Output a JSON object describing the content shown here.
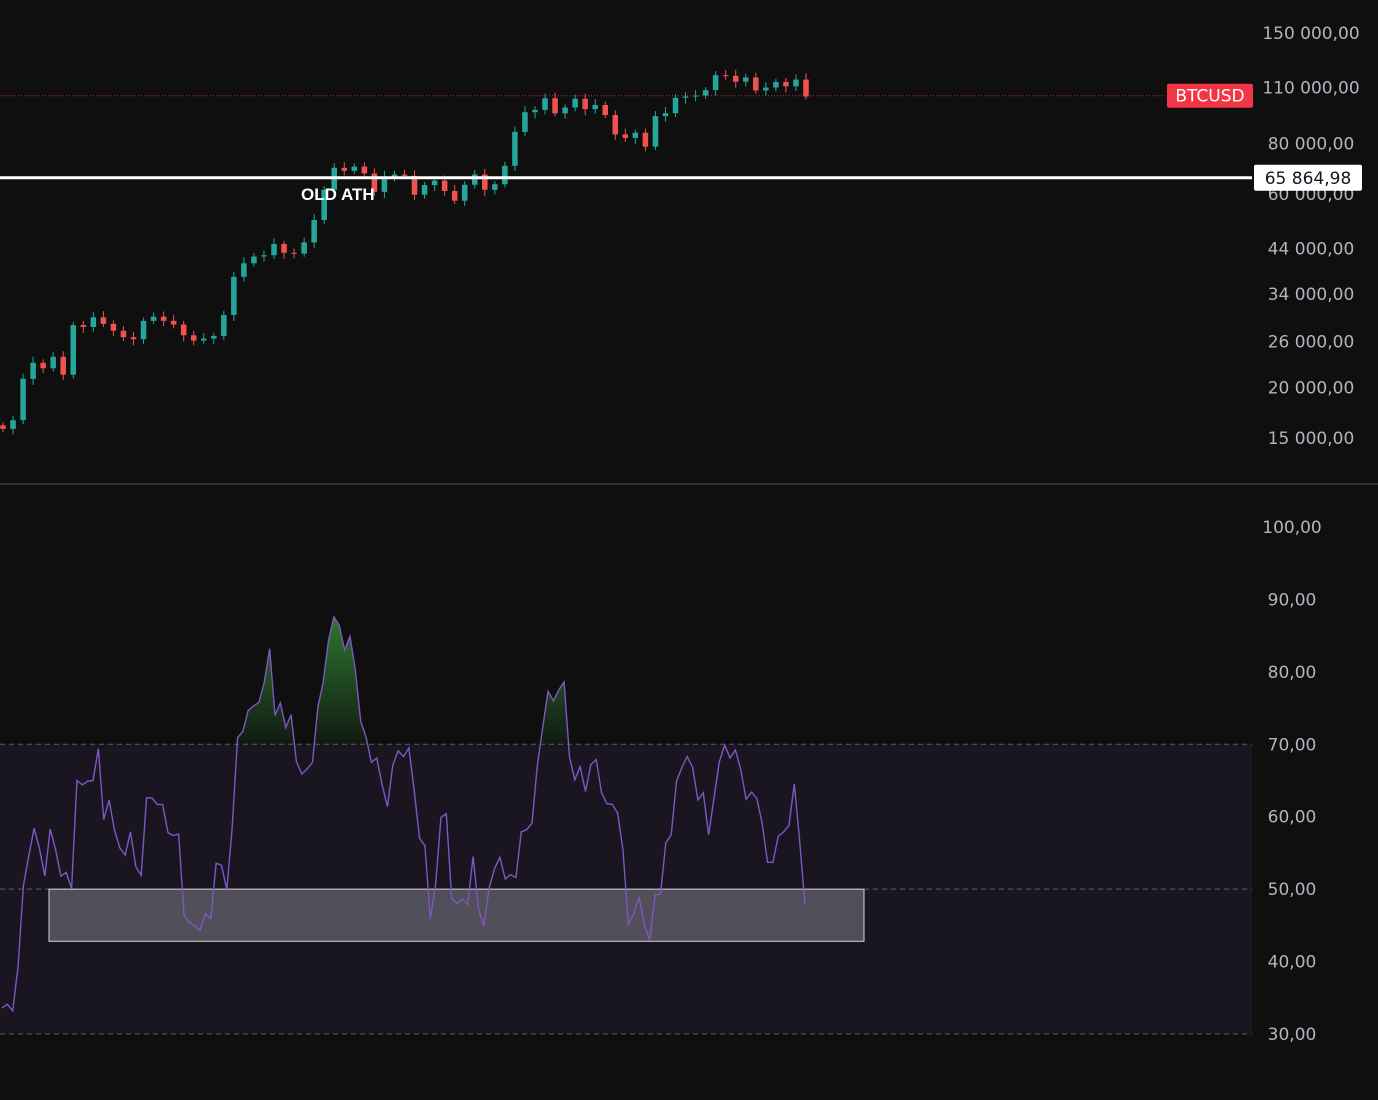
{
  "chart_data": [
    {
      "type": "candlestick",
      "symbol_tag": "BTCUSD",
      "scale": "log",
      "ylim": [
        12500,
        175000
      ],
      "y_ticks": [
        "150 000,00",
        "110 000,00",
        "80 000,00",
        "60 000,00",
        "44 000,00",
        "34 000,00",
        "26 000,00",
        "20 000,00",
        "15 000,00"
      ],
      "y_tick_values": [
        150000,
        110000,
        80000,
        60000,
        44000,
        34000,
        26000,
        20000,
        15000
      ],
      "horizontal_line": {
        "value": 65864.98,
        "label": "65 864,98",
        "annotation": "OLD ATH",
        "color": "#ffffff"
      },
      "last_price_line_value": 105000,
      "colors": {
        "up": "#26a69a",
        "down": "#ef5350",
        "tag": "#f23645"
      },
      "close_series": [
        15800,
        16600,
        21000,
        23000,
        22300,
        23800,
        21500,
        28500,
        28200,
        29800,
        28700,
        27600,
        26600,
        26300,
        29200,
        29900,
        29200,
        28600,
        26900,
        26100,
        26400,
        26800,
        30200,
        37500,
        40500,
        42100,
        42400,
        45200,
        43000,
        42800,
        45600,
        51800,
        61500,
        69700,
        68500,
        70200,
        67500,
        60800,
        66200,
        67100,
        66600,
        59800,
        63200,
        64800,
        61100,
        57800,
        63300,
        67100,
        61500,
        63500,
        70500,
        85500,
        95600,
        96900,
        103500,
        95000,
        98200,
        103200,
        97300,
        99600,
        94100,
        84300,
        82600,
        85100,
        78600,
        93500,
        95100,
        103800,
        104500,
        105100,
        108400,
        118000,
        117600,
        113700,
        116500,
        108200,
        110000,
        113500,
        110800,
        115100,
        104500
      ],
      "y_unit": "USD"
    },
    {
      "type": "line",
      "series_name": "",
      "ylim": [
        30,
        100
      ],
      "y_ticks": [
        "100,00",
        "90,00",
        "80,00",
        "70,00",
        "60,00",
        "50,00",
        "40,00",
        "30,00"
      ],
      "y_tick_values": [
        100,
        90,
        80,
        70,
        60,
        50,
        40,
        30
      ],
      "band": {
        "upper": 70,
        "lower": 30,
        "middle": 50
      },
      "highlight_box": {
        "x_start_index": 12,
        "x_end_index": 211,
        "y_low": 42.8,
        "y_high": 50
      },
      "line_color": "#7e57c2",
      "overbought_fill": "#2e7d32",
      "values": [
        33.6,
        34.1,
        33.2,
        39.3,
        50.5,
        54.6,
        58.4,
        55.6,
        51.8,
        58.3,
        55.5,
        51.8,
        52.3,
        50.1,
        65.0,
        64.4,
        64.9,
        65.0,
        69.4,
        59.6,
        62.3,
        58.2,
        55.7,
        54.7,
        57.9,
        53.1,
        51.9,
        62.6,
        62.6,
        61.7,
        61.7,
        57.8,
        57.4,
        57.6,
        46.4,
        45.4,
        44.9,
        44.3,
        46.6,
        45.9,
        53.6,
        53.3,
        49.9,
        58.5,
        70.9,
        71.8,
        74.7,
        75.3,
        75.8,
        78.6,
        83.2,
        74.0,
        75.7,
        72.3,
        74.1,
        67.6,
        65.9,
        66.6,
        67.5,
        75.1,
        78.6,
        84.4,
        87.6,
        86.4,
        83.0,
        84.9,
        80.3,
        73.2,
        71.0,
        67.5,
        68.1,
        64.4,
        61.4,
        67.1,
        69.1,
        68.3,
        69.5,
        63.6,
        57.0,
        56.0,
        45.9,
        50.6,
        59.9,
        60.4,
        48.7,
        48.0,
        48.6,
        47.9,
        54.5,
        47.3,
        44.9,
        50.2,
        52.8,
        54.4,
        51.4,
        52.0,
        51.6,
        57.9,
        58.2,
        59.1,
        67.1,
        72.3,
        77.3,
        76.0,
        77.5,
        78.6,
        68.3,
        65.1,
        66.9,
        63.5,
        67.2,
        67.9,
        63.3,
        61.8,
        61.7,
        60.5,
        55.4,
        45.1,
        46.6,
        48.9,
        45.0,
        43.0,
        49.2,
        49.3,
        56.4,
        57.5,
        64.9,
        66.8,
        68.3,
        66.8,
        62.3,
        63.3,
        57.5,
        62.6,
        67.6,
        69.9,
        68.1,
        69.2,
        66.5,
        62.4,
        63.4,
        62.5,
        59.1,
        53.7,
        53.7,
        57.3,
        57.9,
        58.8,
        64.5,
        56.7,
        47.8
      ],
      "x_positions_note": ""
    }
  ]
}
